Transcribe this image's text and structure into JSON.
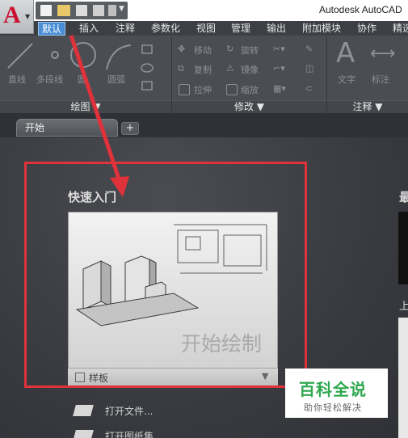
{
  "app": {
    "logo_letter": "A",
    "window_title": "Autodesk AutoCAD"
  },
  "ribbon_tabs": [
    {
      "label": "默认",
      "active": true
    },
    {
      "label": "插入"
    },
    {
      "label": "注释"
    },
    {
      "label": "参数化"
    },
    {
      "label": "视图"
    },
    {
      "label": "管理"
    },
    {
      "label": "输出"
    },
    {
      "label": "附加模块"
    },
    {
      "label": "协作"
    },
    {
      "label": "精选"
    }
  ],
  "ribbon": {
    "draw_tools": {
      "line": "直线",
      "polyline": "多段线",
      "circle": "圆",
      "arc": "圆弧"
    },
    "modify_tools": {
      "move": "移动",
      "rotate": "旋转",
      "copy": "复制",
      "mirror": "镜像",
      "stretch": "拉伸",
      "scale": "缩放"
    },
    "annotation_tools": {
      "text": "文字",
      "dimension": "标注"
    },
    "panels": {
      "draw": "绘图 ▼",
      "modify": "修改 ▼",
      "annotation": "注释 ▼"
    }
  },
  "file_tabs": {
    "start": "开始",
    "add": "+"
  },
  "start_page": {
    "get_started_title": "快速入门",
    "card_caption": "开始绘制",
    "templates_label": "样板",
    "templates_arrow": "▼",
    "open_files": "打开文件...",
    "open_sheet_set": "打开图纸集...",
    "recent_title": "最",
    "right_label": "上"
  },
  "watermark": {
    "main": "百科全说",
    "sub": "助你轻松解决"
  },
  "colors": {
    "accent_tab": "#4a8dd4",
    "highlight_red": "#e0323a",
    "logo_red": "#c8102e",
    "watermark_green": "#2ea84f"
  }
}
